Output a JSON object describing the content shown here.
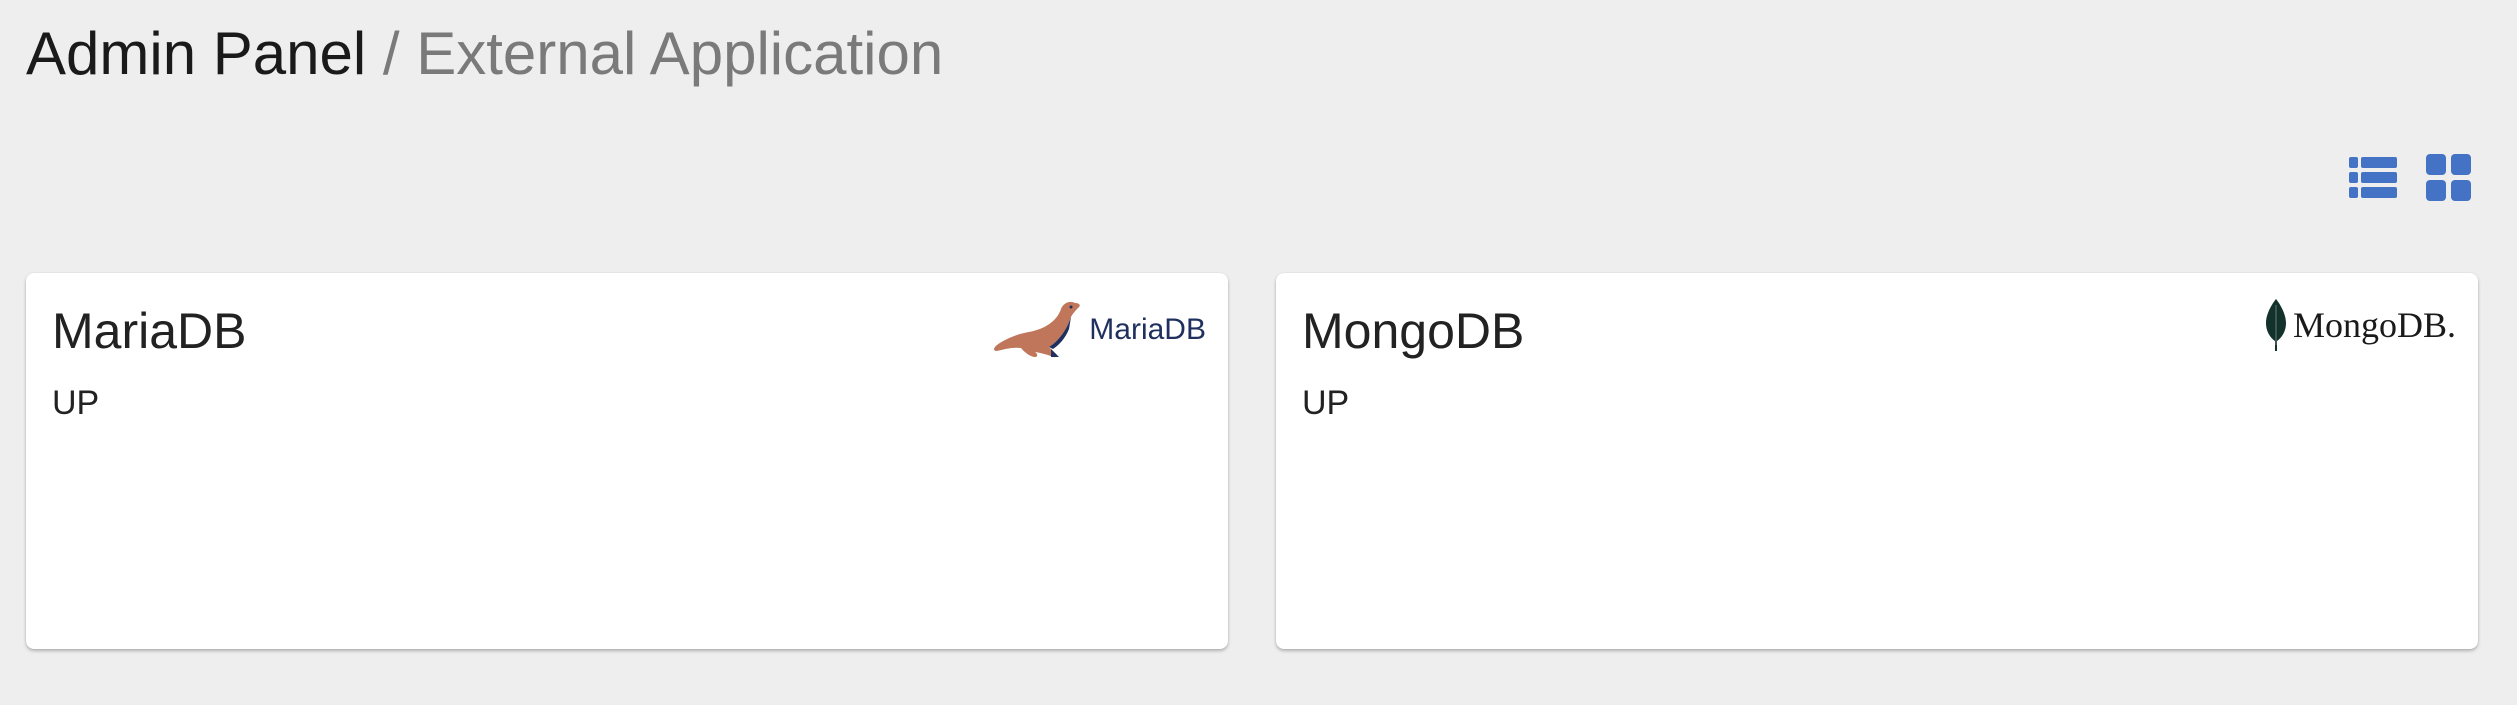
{
  "breadcrumb": {
    "root": "Admin Panel",
    "separator": " / ",
    "current": "External Application"
  },
  "view_toggle": {
    "list_icon": "list-icon",
    "grid_icon": "grid-icon",
    "accent_color": "#4472c4"
  },
  "applications": [
    {
      "name": "MariaDB",
      "status": "UP",
      "logo": {
        "icon": "sea-lion-icon",
        "text": "MariaDB"
      }
    },
    {
      "name": "MongoDB",
      "status": "UP",
      "logo": {
        "icon": "leaf-icon",
        "text": "MongoDB."
      }
    }
  ]
}
